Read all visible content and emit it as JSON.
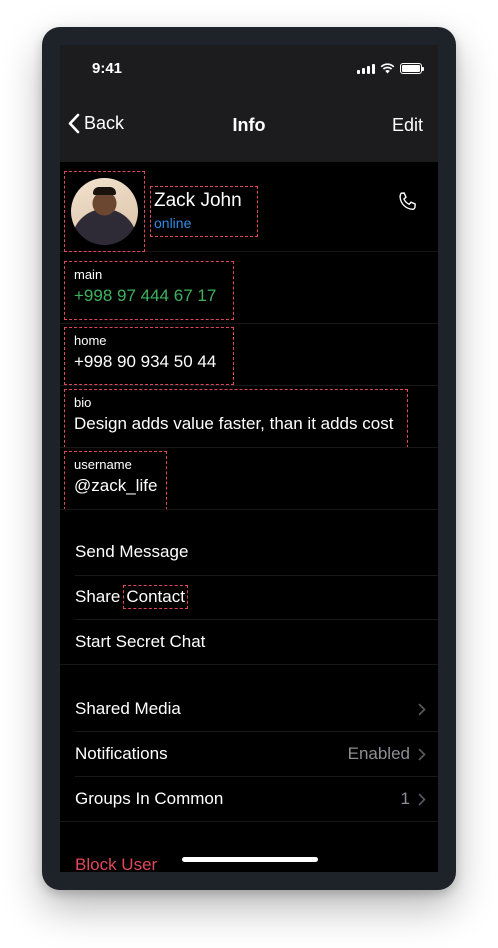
{
  "status_bar": {
    "time": "9:41"
  },
  "nav": {
    "back_label": "Back",
    "title": "Info",
    "edit_label": "Edit"
  },
  "profile": {
    "name": "Zack John",
    "status": "online"
  },
  "fields": [
    {
      "label": "main",
      "value": "+998 97 444 67 17"
    },
    {
      "label": "home",
      "value": "+998 90 934 50 44"
    },
    {
      "label": "bio",
      "value": "Design adds value faster, than it adds cost"
    },
    {
      "label": "username",
      "value": "@zack_life"
    }
  ],
  "actions": {
    "send_message": "Send Message",
    "share_word": "Share",
    "contact_word": "Contact",
    "secret_chat": "Start Secret Chat"
  },
  "settings": {
    "shared_media": "Shared Media",
    "notifications": "Notifications",
    "notifications_value": "Enabled",
    "groups": "Groups In Common",
    "groups_value": "1"
  },
  "block_user": "Block User",
  "colors": {
    "accent_blue": "#2f8ce6",
    "phone_green": "#3fb25e",
    "danger_red": "#e0485a"
  }
}
